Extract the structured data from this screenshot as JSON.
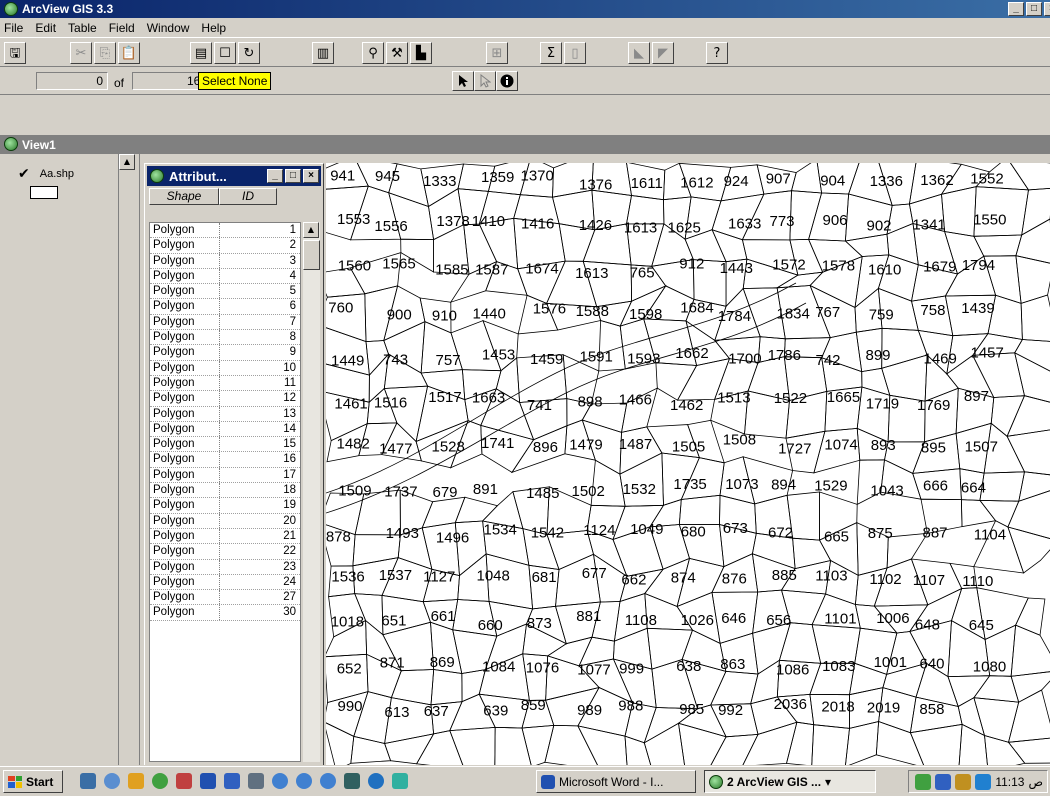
{
  "app": {
    "title": "ArcView GIS 3.3"
  },
  "menu": [
    {
      "label": "File"
    },
    {
      "label": "Edit"
    },
    {
      "label": "Table"
    },
    {
      "label": "Field"
    },
    {
      "label": "Window"
    },
    {
      "label": "Help"
    }
  ],
  "toolbar": {
    "buttons": [
      {
        "name": "save-icon",
        "glyph": "🖫"
      },
      {
        "name": "cut-icon",
        "glyph": "✂"
      },
      {
        "name": "copy-icon",
        "glyph": "⎘"
      },
      {
        "name": "paste-icon",
        "glyph": "📋"
      },
      {
        "name": "select-all-icon",
        "glyph": "▤"
      },
      {
        "name": "select-none-icon",
        "glyph": "☐"
      },
      {
        "name": "switch-selection-icon",
        "glyph": "↻"
      },
      {
        "name": "chart-icon",
        "glyph": "▥"
      },
      {
        "name": "find-icon",
        "glyph": "⚲"
      },
      {
        "name": "query-icon",
        "glyph": "⚒"
      },
      {
        "name": "promote-icon",
        "glyph": "▙"
      },
      {
        "name": "join-icon",
        "glyph": "⊞"
      },
      {
        "name": "summarize-icon",
        "glyph": "Σ"
      },
      {
        "name": "calculate-icon",
        "glyph": "▯"
      },
      {
        "name": "sort-ascending-icon",
        "glyph": "◣"
      },
      {
        "name": "sort-descending-icon",
        "glyph": "◤"
      },
      {
        "name": "help-icon",
        "glyph": "?"
      }
    ]
  },
  "selection": {
    "selected_count": "0",
    "of_label": "of",
    "total_count": "168",
    "tooltip": "Select None"
  },
  "view": {
    "title": "View1"
  },
  "toc": {
    "theme_name": "Aa.shp",
    "checked": true
  },
  "attributes": {
    "title": "Attribut...",
    "columns": [
      "Shape",
      "ID"
    ],
    "rows": [
      {
        "shape": "Polygon",
        "id": "1"
      },
      {
        "shape": "Polygon",
        "id": "2"
      },
      {
        "shape": "Polygon",
        "id": "3"
      },
      {
        "shape": "Polygon",
        "id": "4"
      },
      {
        "shape": "Polygon",
        "id": "5"
      },
      {
        "shape": "Polygon",
        "id": "6"
      },
      {
        "shape": "Polygon",
        "id": "7"
      },
      {
        "shape": "Polygon",
        "id": "8"
      },
      {
        "shape": "Polygon",
        "id": "9"
      },
      {
        "shape": "Polygon",
        "id": "10"
      },
      {
        "shape": "Polygon",
        "id": "11"
      },
      {
        "shape": "Polygon",
        "id": "12"
      },
      {
        "shape": "Polygon",
        "id": "13"
      },
      {
        "shape": "Polygon",
        "id": "14"
      },
      {
        "shape": "Polygon",
        "id": "15"
      },
      {
        "shape": "Polygon",
        "id": "16"
      },
      {
        "shape": "Polygon",
        "id": "17"
      },
      {
        "shape": "Polygon",
        "id": "18"
      },
      {
        "shape": "Polygon",
        "id": "19"
      },
      {
        "shape": "Polygon",
        "id": "20"
      },
      {
        "shape": "Polygon",
        "id": "21"
      },
      {
        "shape": "Polygon",
        "id": "22"
      },
      {
        "shape": "Polygon",
        "id": "23"
      },
      {
        "shape": "Polygon",
        "id": "24"
      },
      {
        "shape": "Polygon",
        "id": "27"
      },
      {
        "shape": "Polygon",
        "id": "30"
      }
    ]
  },
  "map": {
    "parcel_labels": [
      "941",
      "945",
      "1333",
      "1359",
      "1370",
      "1376",
      "1611",
      "1612",
      "924",
      "907",
      "904",
      "1336",
      "1362",
      "1552",
      "1553",
      "1556",
      "1378",
      "1410",
      "1416",
      "1426",
      "1613",
      "1625",
      "1633",
      "773",
      "906",
      "902",
      "1341",
      "1550",
      "1560",
      "1565",
      "1585",
      "1587",
      "1674",
      "1613",
      "765",
      "912",
      "1443",
      "1572",
      "1578",
      "1610",
      "1679",
      "1794",
      "760",
      "900",
      "910",
      "1440",
      "1576",
      "1588",
      "1598",
      "1684",
      "1784",
      "1834",
      "767",
      "759",
      "758",
      "1439",
      "1449",
      "743",
      "757",
      "1453",
      "1459",
      "1591",
      "1593",
      "1662",
      "1700",
      "1786",
      "742",
      "899",
      "1469",
      "1457",
      "1461",
      "1516",
      "1517",
      "1663",
      "741",
      "898",
      "1466",
      "1462",
      "1513",
      "1522",
      "1665",
      "1719",
      "1769",
      "897",
      "1482",
      "1477",
      "1528",
      "1741",
      "896",
      "1479",
      "1487",
      "1505",
      "1508",
      "1727",
      "1074",
      "893",
      "895",
      "1507",
      "1509",
      "1737",
      "679",
      "891",
      "1485",
      "1502",
      "1532",
      "1735",
      "1073",
      "894",
      "1529",
      "1043",
      "666",
      "664",
      "878",
      "1493",
      "1496",
      "1534",
      "1542",
      "1124",
      "1049",
      "680",
      "673",
      "672",
      "665",
      "875",
      "887",
      "1104",
      "1536",
      "1537",
      "1127",
      "1048",
      "681",
      "677",
      "662",
      "874",
      "876",
      "885",
      "1103",
      "1102",
      "1107",
      "1110",
      "1018",
      "651",
      "661",
      "660",
      "873",
      "881",
      "1108",
      "1026",
      "646",
      "656",
      "1101",
      "1006",
      "648",
      "645",
      "652",
      "871",
      "869",
      "1084",
      "1076",
      "1077",
      "999",
      "638",
      "863",
      "1086",
      "1083",
      "1001",
      "640",
      "1080",
      "990",
      "613",
      "637",
      "639",
      "859",
      "989",
      "988",
      "985",
      "992",
      "2036",
      "2018",
      "2019",
      "858"
    ]
  },
  "taskbar": {
    "start_label": "Start",
    "tasks": [
      {
        "label": "Microsoft Word - I...",
        "active": false
      },
      {
        "label": "2 ArcView GIS ...",
        "active": true
      }
    ],
    "clock": "11:13",
    "clock_suffix": "ص"
  }
}
